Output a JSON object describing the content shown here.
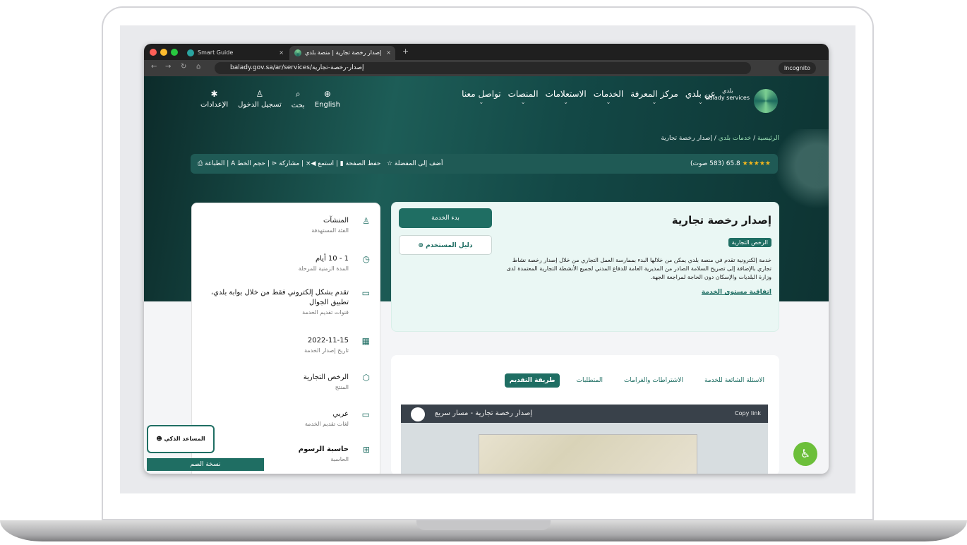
{
  "browser": {
    "tabs": [
      {
        "title": "Smart Guide",
        "close": "×"
      },
      {
        "title": "إصدار رخصة تجارية | منصة بلدي",
        "close": "×"
      }
    ],
    "new_tab": "+",
    "url": "balady.gov.sa/ar/services/إصدار-رخصة-تجارية",
    "incognito": "Incognito"
  },
  "header": {
    "logo_text": "بلدي",
    "logo_sub": "balady services",
    "nav": [
      "عن بلدي",
      "مركز المعرفة",
      "الخدمات",
      "الاستعلامات",
      "المنصات",
      "تواصل معنا"
    ],
    "tools": [
      {
        "icon": "globe-icon",
        "label": "English"
      },
      {
        "icon": "search-icon",
        "label": "بحث"
      },
      {
        "icon": "user-icon",
        "label": "تسجيل الدخول"
      },
      {
        "icon": "gear-icon",
        "label": "الإعدادات"
      }
    ]
  },
  "breadcrumb": {
    "home": "الرئيسية",
    "services": "خدمات بلدي",
    "current": "إصدار رخصة تجارية"
  },
  "actions": {
    "rating": "65.8",
    "rating_votes": "(583 صوت)",
    "add_favorite": "أضف إلى المفضلة",
    "save_page": "حفظ الصفحة",
    "listen": "استمع",
    "share": "مشاركة",
    "font_size": "حجم الخط",
    "print": "الطباعة"
  },
  "service": {
    "title": "إصدار رخصة تجارية",
    "category": "الرخص التجارية",
    "description": "خدمة إلكترونية تقدم في منصة بلدي يمكن من خلالها البدء بممارسة العمل التجاري من خلال إصدار رخصة نشاط تجاري بالإضافة إلى تصريح السلامة الصادر من المديرية العامة للدفاع المدني لجميع الأنشطة التجارية المعتمدة لدى وزارة البلديات والإسكان دون الحاجة لمراجعة الجهة.",
    "sla": "اتفاقية مستوى الخدمة",
    "start_button": "بدء الخدمة",
    "guide_button": "دليل المستخدم"
  },
  "side_info": [
    {
      "icon": "user-icon",
      "title": "المنشآت",
      "sub": "الفئة المستهدفة"
    },
    {
      "icon": "clock-icon",
      "title": "1 - 10 أيام",
      "sub": "المدة الزمنية للمرحلة"
    },
    {
      "icon": "monitor-icon",
      "title": "تقدم بشكل إلكتروني فقط من خلال بوابة بلدي، تطبيق الجوال",
      "sub": "قنوات تقديم الخدمة"
    },
    {
      "icon": "calendar-icon",
      "title": "2022-11-15",
      "sub": "تاريخ إصدار الخدمة"
    },
    {
      "icon": "box-icon",
      "title": "الرخص التجارية",
      "sub": "المنتج"
    },
    {
      "icon": "monitor-icon",
      "title": "عربي",
      "sub": "لغات تقديم الخدمة"
    },
    {
      "icon": "calculator-icon",
      "title": "حاسبة الرسوم",
      "sub": "الحاسبة"
    }
  ],
  "content_tabs": [
    "طريقة التقديم",
    "المتطلبات",
    "الاشتراطات والغرامات",
    "الاسئلة الشائعة للخدمة"
  ],
  "video": {
    "title": "إصدار رخصة تجارية - مسار سريع",
    "copy": "Copy link"
  },
  "helper": "المساعد الذكي",
  "deaf_version": "نسخة الصم"
}
